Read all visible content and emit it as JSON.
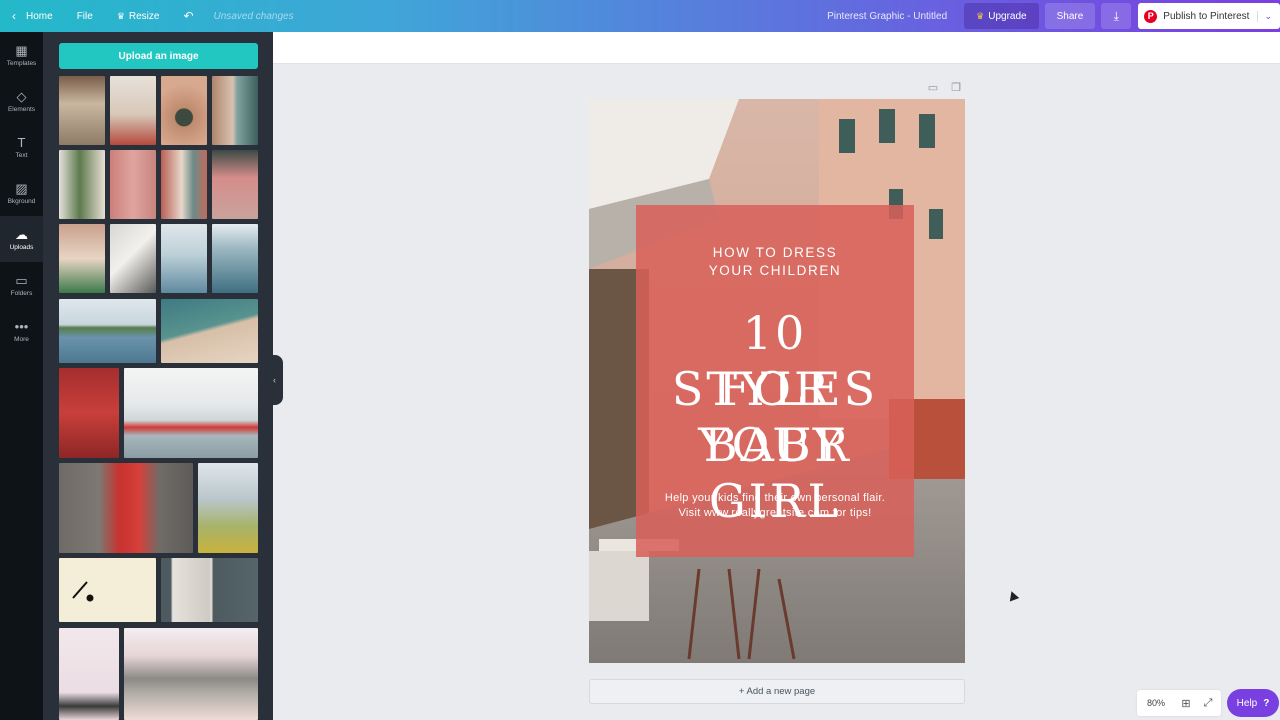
{
  "topbar": {
    "home": "Home",
    "file": "File",
    "resize": "Resize",
    "unsaved": "Unsaved changes",
    "title": "Pinterest Graphic - Untitled",
    "upgrade": "Upgrade",
    "share": "Share",
    "publish": "Publish to Pinterest"
  },
  "rail": {
    "items": [
      {
        "label": "Templates",
        "icon": "templates-icon"
      },
      {
        "label": "Elements",
        "icon": "elements-icon"
      },
      {
        "label": "Text",
        "icon": "text-icon"
      },
      {
        "label": "Bkground",
        "icon": "background-icon"
      },
      {
        "label": "Uploads",
        "icon": "upload-cloud-icon"
      },
      {
        "label": "Folders",
        "icon": "folder-icon"
      },
      {
        "label": "More",
        "icon": "more-dots-icon"
      }
    ]
  },
  "panel": {
    "upload_label": "Upload an image"
  },
  "canvas": {
    "subtitle_line1": "HOW TO DRESS",
    "subtitle_line2": "YOUR CHILDREN",
    "title_line1": "10 STYLES",
    "title_line2": "FOR YOUR",
    "title_line3": "BABY GIRL",
    "body_line1": "Help your kids find their own personal flair.",
    "body_line2": "Visit www.reallygreatsite.com for tips!",
    "overlay_color": "#d96058"
  },
  "add_page": "+ Add a new page",
  "zoom": "80%",
  "help": "Help",
  "colors": {
    "accent_teal": "#22c7c2",
    "accent_purple": "#7a3fe0",
    "pinterest_red": "#e60023"
  }
}
